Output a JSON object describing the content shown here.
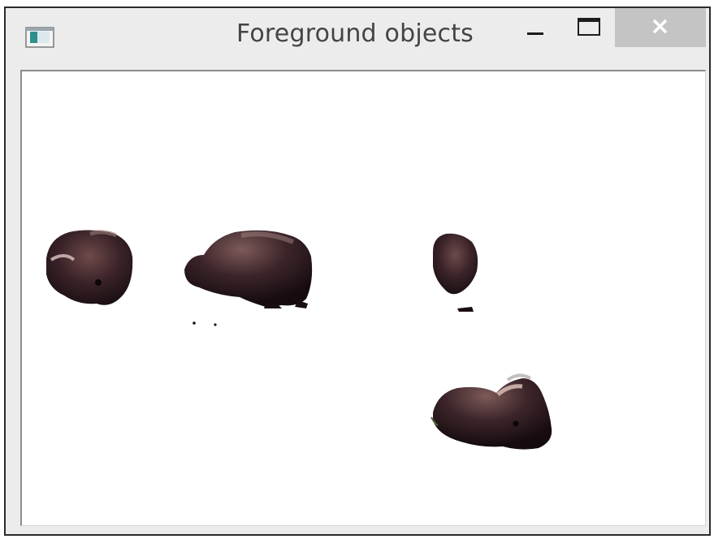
{
  "window": {
    "title": "Foreground objects"
  },
  "titlebar_buttons": {
    "minimize_icon": "minimize-icon",
    "maximize_icon": "maximize-icon",
    "close_icon": "close-icon",
    "close_bg": "#c4c4c4"
  },
  "content": {
    "background": "#ffffff",
    "objects": [
      {
        "name": "musk-ox-1",
        "description_icon": "musk-ox"
      },
      {
        "name": "musk-ox-2",
        "description_icon": "musk-ox"
      },
      {
        "name": "musk-ox-3",
        "description_icon": "musk-ox"
      },
      {
        "name": "musk-ox-4",
        "description_icon": "musk-ox"
      }
    ]
  }
}
